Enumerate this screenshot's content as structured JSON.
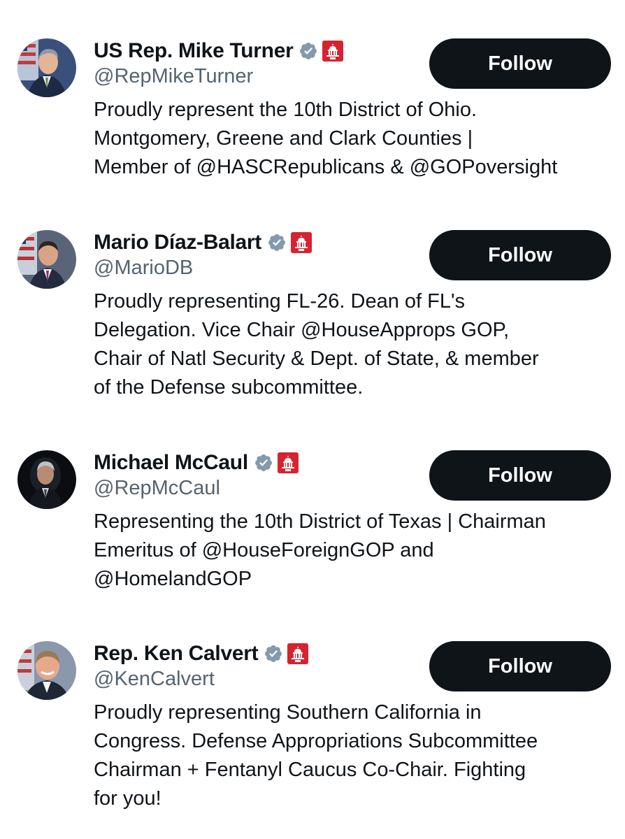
{
  "colors": {
    "text": "#0f1419",
    "secondary_text": "#536471",
    "button_bg": "#0f1419",
    "button_text": "#ffffff",
    "verified_badge": "#829aab",
    "affiliation_badge": "#d6232f"
  },
  "users": [
    {
      "display_name": "US Rep. Mike Turner",
      "handle": "@RepMikeTurner",
      "bio_lines": [
        "Proudly represent the 10th District of Ohio.",
        "Montgomery, Greene and Clark Counties |",
        "Member of @HASCRepublicans & @GOPoversight"
      ],
      "follow_label": "Follow",
      "verified_icon": "verified-badge-icon",
      "affiliation_icon": "house-gop-affiliation-icon"
    },
    {
      "display_name": "Mario Díaz-Balart",
      "handle": "@MarioDB",
      "bio_lines": [
        "Proudly representing FL-26. Dean of FL's",
        "Delegation. Vice Chair @HouseApprops GOP,",
        "Chair of Natl Security & Dept. of State, & member",
        "of the Defense subcommittee."
      ],
      "follow_label": "Follow",
      "verified_icon": "verified-badge-icon",
      "affiliation_icon": "house-gop-affiliation-icon"
    },
    {
      "display_name": "Michael McCaul",
      "handle": "@RepMcCaul",
      "bio_lines": [
        "Representing the 10th District of Texas | Chairman",
        "Emeritus of @HouseForeignGOP and",
        "@HomelandGOP"
      ],
      "follow_label": "Follow",
      "verified_icon": "verified-badge-icon",
      "affiliation_icon": "house-gop-affiliation-icon"
    },
    {
      "display_name": "Rep. Ken Calvert",
      "handle": "@KenCalvert",
      "bio_lines": [
        "Proudly representing Southern California in",
        "Congress. Defense Appropriations Subcommittee",
        "Chairman + Fentanyl Caucus Co-Chair. Fighting",
        "for you!"
      ],
      "follow_label": "Follow",
      "verified_icon": "verified-badge-icon",
      "affiliation_icon": "house-gop-affiliation-icon"
    }
  ]
}
